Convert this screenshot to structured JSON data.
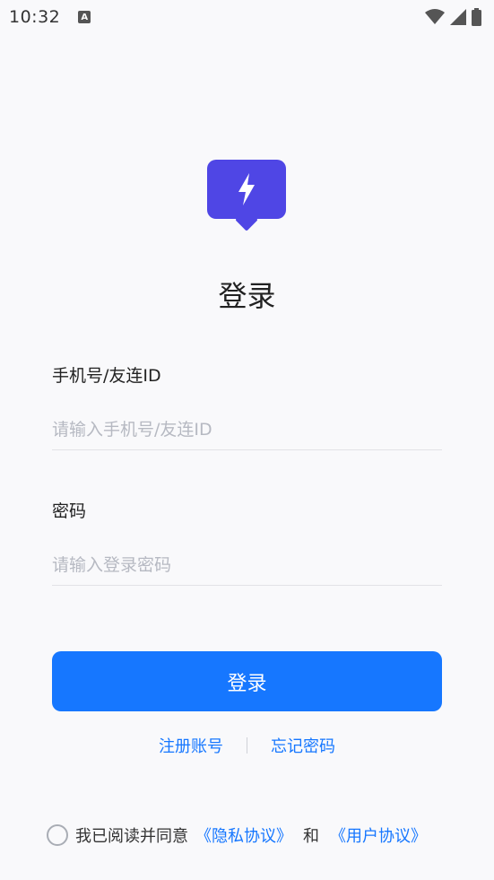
{
  "status_bar": {
    "time": "10:32",
    "notification_icon": "A",
    "icons": [
      "wifi-icon",
      "signal-icon",
      "battery-icon"
    ]
  },
  "logo": {
    "icon": "lightning-bolt-icon",
    "color": "#4f46e5"
  },
  "title": "登录",
  "phone_field": {
    "label": "手机号/友连ID",
    "placeholder": "请输入手机号/友连ID"
  },
  "password_field": {
    "label": "密码",
    "placeholder": "请输入登录密码"
  },
  "login_button": {
    "label": "登录",
    "color": "#1677ff"
  },
  "links": {
    "register": "注册账号",
    "forgot_password": "忘记密码"
  },
  "agreement": {
    "text": "我已阅读并同意",
    "privacy_link": "《隐私协议》",
    "and": "和",
    "user_link": "《用户协议》"
  }
}
